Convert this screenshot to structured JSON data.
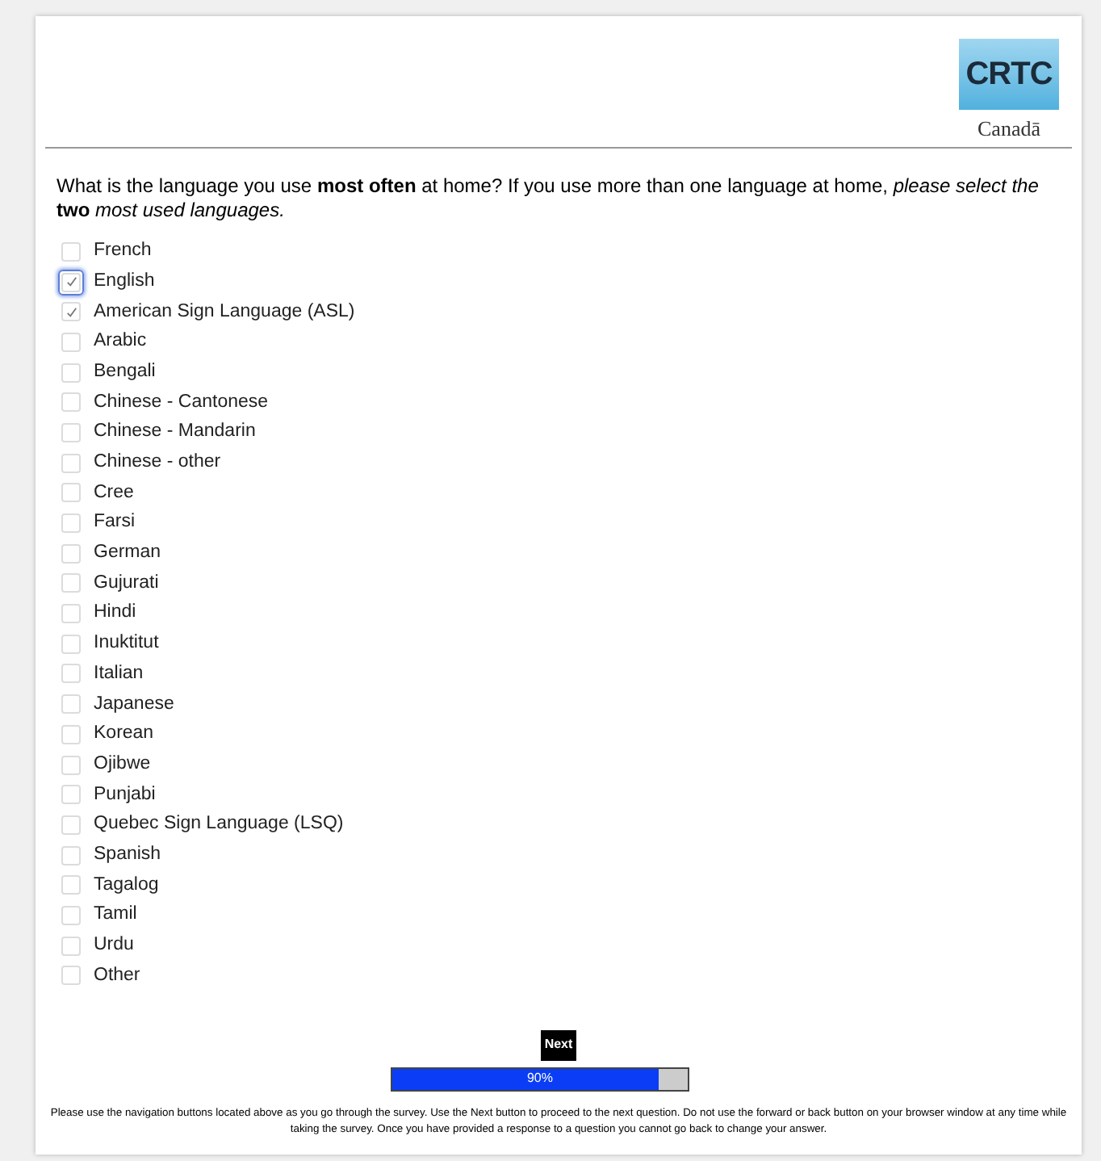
{
  "logo": {
    "title": "CRTC",
    "wordmark": "Canadā"
  },
  "question": "What is the language you use **most often** at home? If you use more than one language at home, *please select the* **two** *most used languages.*",
  "options": [
    {
      "label": "French",
      "checked": false,
      "focused": false
    },
    {
      "label": "English",
      "checked": true,
      "focused": true
    },
    {
      "label": "American Sign Language (ASL)",
      "checked": true,
      "focused": false
    },
    {
      "label": "Arabic",
      "checked": false,
      "focused": false
    },
    {
      "label": "Bengali",
      "checked": false,
      "focused": false
    },
    {
      "label": "Chinese - Cantonese",
      "checked": false,
      "focused": false
    },
    {
      "label": "Chinese - Mandarin",
      "checked": false,
      "focused": false
    },
    {
      "label": "Chinese - other",
      "checked": false,
      "focused": false
    },
    {
      "label": "Cree",
      "checked": false,
      "focused": false
    },
    {
      "label": "Farsi",
      "checked": false,
      "focused": false
    },
    {
      "label": "German",
      "checked": false,
      "focused": false
    },
    {
      "label": "Gujurati",
      "checked": false,
      "focused": false
    },
    {
      "label": "Hindi",
      "checked": false,
      "focused": false
    },
    {
      "label": "Inuktitut",
      "checked": false,
      "focused": false
    },
    {
      "label": "Italian",
      "checked": false,
      "focused": false
    },
    {
      "label": "Japanese",
      "checked": false,
      "focused": false
    },
    {
      "label": "Korean",
      "checked": false,
      "focused": false
    },
    {
      "label": "Ojibwe",
      "checked": false,
      "focused": false
    },
    {
      "label": "Punjabi",
      "checked": false,
      "focused": false
    },
    {
      "label": "Quebec Sign Language (LSQ)",
      "checked": false,
      "focused": false
    },
    {
      "label": "Spanish",
      "checked": false,
      "focused": false
    },
    {
      "label": "Tagalog",
      "checked": false,
      "focused": false
    },
    {
      "label": "Tamil",
      "checked": false,
      "focused": false
    },
    {
      "label": "Urdu",
      "checked": false,
      "focused": false
    },
    {
      "label": "Other",
      "checked": false,
      "focused": false
    }
  ],
  "next_button": "Next",
  "progress": {
    "level": 0.9,
    "reading": "90%"
  },
  "footer": "Please use the navigation buttons located above as you go through the survey. Use the Next button to proceed to the next question. Do not use the forward or back button on your browser window at any time while taking the survey. Once you have provided a response to a question you cannot go back to change your answer."
}
